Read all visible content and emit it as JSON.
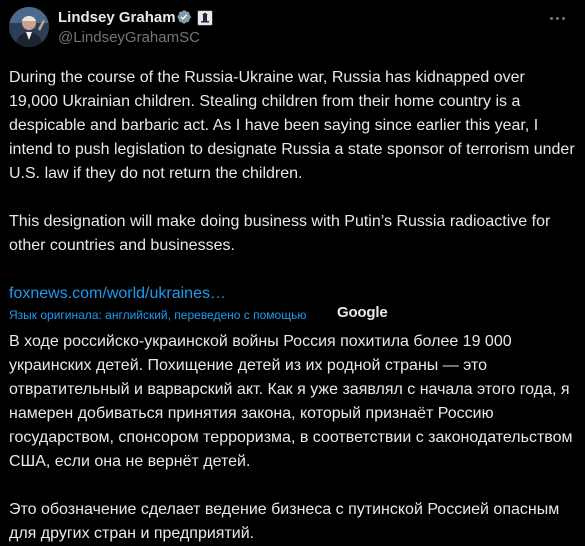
{
  "tweet": {
    "author_name": "Lindsey Graham",
    "handle": "@LindseyGrahamSC",
    "body": [
      "During the course of the Russia-Ukraine war, Russia has kidnapped over 19,000 Ukrainian children. Stealing children from their home country is a despicable and barbaric act. As I have been saying since earlier this year, I intend to push legislation to designate Russia a state sponsor of terrorism under U.S. law if they do not return the children.",
      "This designation will make doing business with Putin’s Russia radioactive for other countries and businesses."
    ],
    "link_text": "foxnews.com/world/ukraines…"
  },
  "translation": {
    "note": "Язык оригинала: английский, переведено с помощью",
    "provider": "Google",
    "body": [
      "В ходе российско-украинской войны Россия похитила более 19 000 украинских детей. Похищение детей из их родной страны — это отвратительный и варварский акт. Как я уже заявлял с начала этого года, я намерен добиваться принятия закона, который признаёт Россию государством, спонсором терроризма, в соответствии с законодательством США, если она не вернёт детей.",
      "Это обозначение сделает ведение бизнеса с путинской Россией опасным для других стран и предприятий."
    ]
  },
  "icons": {
    "verified": "verified-badge-icon",
    "affiliation": "government-affiliation-icon",
    "more": "more-options-icon"
  },
  "colors": {
    "background": "#000000",
    "text": "#e7e9ea",
    "secondary": "#71767b",
    "link": "#1d9bf0"
  }
}
